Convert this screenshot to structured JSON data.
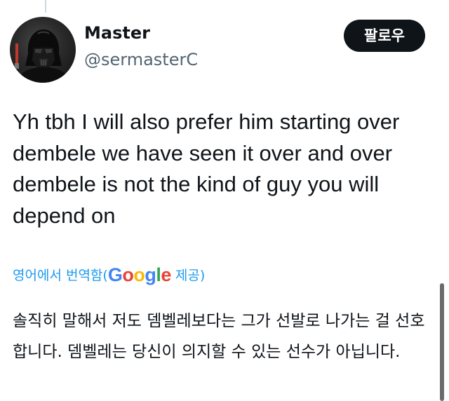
{
  "user": {
    "display_name": "Master",
    "handle": "@sermasterC"
  },
  "follow_button": {
    "label": "팔로우"
  },
  "tweet": {
    "text": "Yh tbh I will also prefer him starting over dembele we have seen it over and over dembele is not the kind of guy you will depend on"
  },
  "translation": {
    "prefix": "영어에서 번역함(",
    "provider_logo": "Google",
    "suffix": " 제공)",
    "text": "솔직히 말해서 저도 뎀벨레보다는 그가 선발로 나가는 걸 선호합니다. 뎀벨레는 당신이 의지할 수 있는 선수가 아닙니다."
  },
  "colors": {
    "follow_bg": "#0f1419",
    "link_blue": "#1d9bf0",
    "secondary_text": "#536471"
  },
  "icons": {
    "avatar": "darth-vader-avatar-icon"
  }
}
